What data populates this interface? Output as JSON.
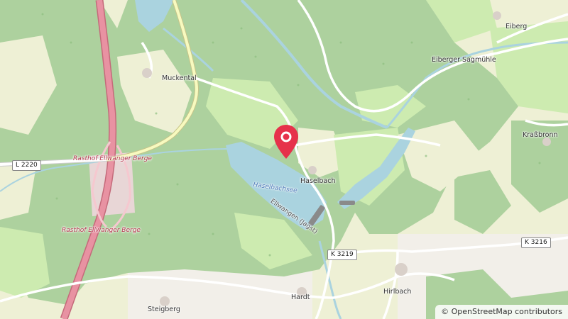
{
  "map": {
    "places": {
      "muckental": "Muckental",
      "eiberg": "Eiberg",
      "eiberger_sagmuehle": "Eiberger Sagmühle",
      "krassbronn": "Kraßbronn",
      "haselbach": "Haselbach",
      "hardt": "Hardt",
      "hirlbach": "Hirlbach",
      "steigberg": "Steigberg"
    },
    "rest_areas": {
      "north": "Rasthof Ellwanger Berge",
      "south": "Rasthof Ellwanger Berge"
    },
    "water": {
      "lake": "Haselbachsee",
      "dam": "Ellwangen (Jagst)"
    },
    "road_refs": {
      "l2220": "L 2220",
      "k3219": "K 3219",
      "k3216": "K 3216"
    },
    "colors": {
      "forest": "#add19e",
      "meadow": "#cdebb0",
      "farmland": "#eef0d5",
      "water": "#aad3df",
      "motorway": "#e892a2",
      "primary": "#f7fabf",
      "marker": "#e6324b"
    }
  },
  "marker": {
    "icon": "map-pin-icon"
  },
  "attribution": {
    "symbol": "©",
    "text": "OpenStreetMap contributors"
  }
}
